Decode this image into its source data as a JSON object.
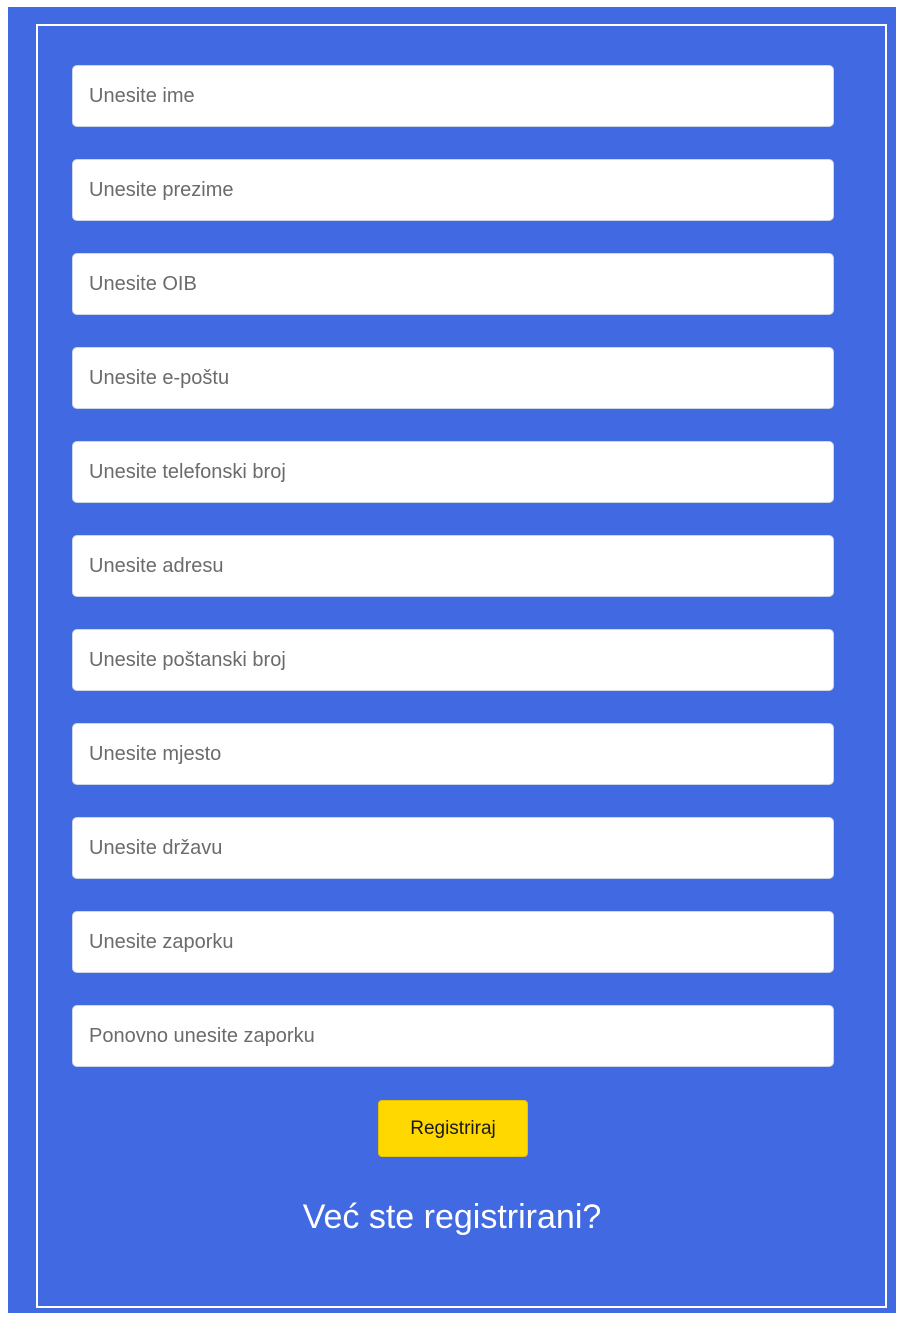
{
  "form": {
    "fields": [
      {
        "placeholder": "Unesite ime",
        "value": ""
      },
      {
        "placeholder": "Unesite prezime",
        "value": ""
      },
      {
        "placeholder": "Unesite OIB",
        "value": ""
      },
      {
        "placeholder": "Unesite e-poštu",
        "value": ""
      },
      {
        "placeholder": "Unesite telefonski broj",
        "value": ""
      },
      {
        "placeholder": "Unesite adresu",
        "value": ""
      },
      {
        "placeholder": "Unesite poštanski broj",
        "value": ""
      },
      {
        "placeholder": "Unesite mjesto",
        "value": ""
      },
      {
        "placeholder": "Unesite državu",
        "value": ""
      },
      {
        "placeholder": "Unesite zaporku",
        "value": ""
      },
      {
        "placeholder": "Ponovno unesite zaporku",
        "value": ""
      }
    ],
    "submit_label": "Registriraj",
    "login_prompt": "Već ste registrirani?"
  },
  "colors": {
    "background": "#4169e1",
    "button": "#ffd800",
    "text_on_background": "#ffffff"
  }
}
